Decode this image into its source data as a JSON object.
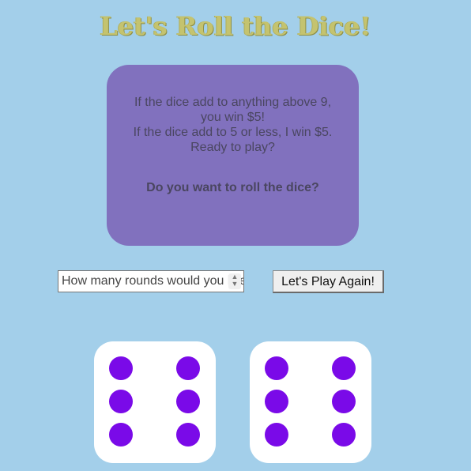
{
  "title": "Let's Roll the Dice!",
  "card": {
    "rules": [
      "If the dice add to anything above 9, you win $5!",
      "If the dice add to 5 or less, I win $5.",
      "Ready to play?"
    ],
    "question": "Do you want to roll the dice?"
  },
  "rounds_input": {
    "placeholder": "How many rounds would you like to play?"
  },
  "play_button": {
    "label": "Let's Play Again!"
  },
  "dice": [
    {
      "value": 6
    },
    {
      "value": 6
    }
  ],
  "colors": {
    "background": "#a3cfea",
    "title": "#c4c36f",
    "card": "#8171be",
    "pip": "#7a0ae8"
  }
}
